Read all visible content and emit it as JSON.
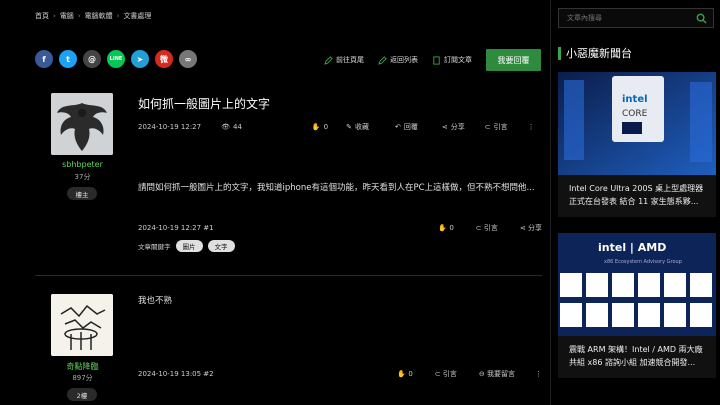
{
  "breadcrumb": [
    "首頁",
    "電腦",
    "電腦軟體",
    "文書處理"
  ],
  "social": [
    {
      "name": "facebook-icon",
      "color": "#3b5998",
      "glyph": "f"
    },
    {
      "name": "twitter-icon",
      "color": "#1da1f2",
      "glyph": "t"
    },
    {
      "name": "threads-icon",
      "color": "#444444",
      "glyph": "@"
    },
    {
      "name": "line-icon",
      "color": "#06c755",
      "glyph": "LINE"
    },
    {
      "name": "telegram-icon",
      "color": "#229ed9",
      "glyph": "➤"
    },
    {
      "name": "weibo-icon",
      "color": "#d52b1e",
      "glyph": "微"
    },
    {
      "name": "link-icon",
      "color": "#777777",
      "glyph": "∞"
    }
  ],
  "actions": {
    "goto_page": "前往頁尾",
    "back_list": "返回列表",
    "subscribe": "訂閱文章",
    "reply": "我要回覆"
  },
  "post1": {
    "title": "如何抓一般圖片上的文字",
    "date": "2024-10-19 12:27",
    "views": "44",
    "likes": "0",
    "collect": "收藏",
    "reply": "回覆",
    "share": "分享",
    "quote": "引言",
    "user": {
      "name": "sbhbpeter",
      "score": "37分",
      "badge": "樓主"
    },
    "body": "請問如何抓一般圖片上的文字，我知道iphone有這個功能，昨天看到人在PC上這樣做，但不熟不想問他...",
    "footer_date": "2024-10-19 12:27 #1",
    "footer_likes": "0",
    "footer_quote": "引言",
    "footer_share": "分享",
    "tags_label": "文章關鍵字",
    "tags": [
      "圖片",
      "文字"
    ]
  },
  "post2": {
    "user": {
      "name": "奇點降臨",
      "score": "897分",
      "badge": "2樓"
    },
    "body": "我也不熟",
    "footer_date": "2024-10-19 13:05 #2",
    "footer_likes": "0",
    "footer_quote": "引言",
    "footer_leave": "我要留言"
  },
  "sidebar": {
    "search_placeholder": "文章內搜尋",
    "title": "小惡魔新聞台",
    "news": [
      {
        "caption": "Intel Core Ultra 200S 桌上型處理器正式在台發表 結合 11 家生態系夥..."
      },
      {
        "caption": "震戰 ARM 架構！Intel / AMD 兩大廠共組 x86 諮詢小組 加速競合開發..."
      }
    ]
  },
  "colors": {
    "accent": "#2e8b3e",
    "username": "#5cd65c",
    "background": "#000000"
  }
}
